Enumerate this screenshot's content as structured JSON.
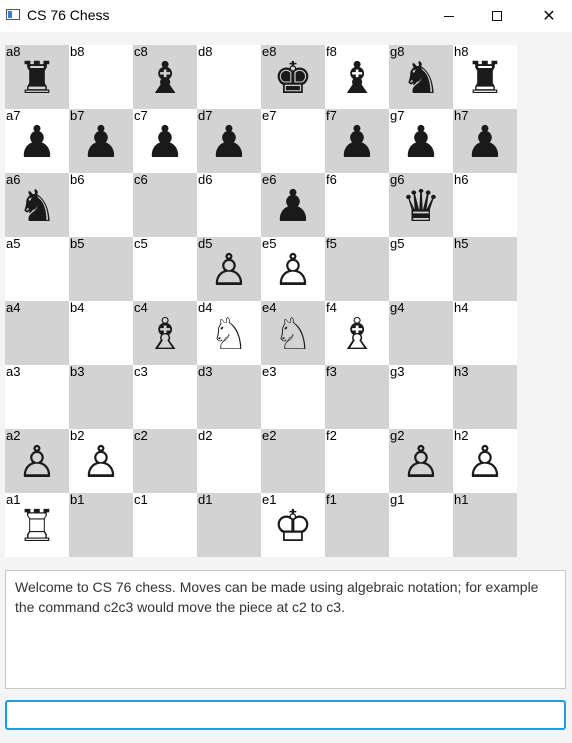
{
  "window": {
    "title": "CS 76 Chess",
    "minimize_glyph": "",
    "maximize_glyph": "",
    "close_glyph": "✕"
  },
  "board": {
    "light_color": "#ffffff",
    "dark_color": "#d3d3d3",
    "files": [
      "a",
      "b",
      "c",
      "d",
      "e",
      "f",
      "g",
      "h"
    ],
    "ranks": [
      "8",
      "7",
      "6",
      "5",
      "4",
      "3",
      "2",
      "1"
    ],
    "pieces": {
      "a8": {
        "glyph": "♜",
        "name": "black-rook"
      },
      "c8": {
        "glyph": "♝",
        "name": "black-bishop"
      },
      "e8": {
        "glyph": "♚",
        "name": "black-king"
      },
      "f8": {
        "glyph": "♝",
        "name": "black-bishop"
      },
      "g8": {
        "glyph": "♞",
        "name": "black-knight"
      },
      "h8": {
        "glyph": "♜",
        "name": "black-rook"
      },
      "a7": {
        "glyph": "♟",
        "name": "black-pawn"
      },
      "b7": {
        "glyph": "♟",
        "name": "black-pawn"
      },
      "c7": {
        "glyph": "♟",
        "name": "black-pawn"
      },
      "d7": {
        "glyph": "♟",
        "name": "black-pawn"
      },
      "f7": {
        "glyph": "♟",
        "name": "black-pawn"
      },
      "g7": {
        "glyph": "♟",
        "name": "black-pawn"
      },
      "h7": {
        "glyph": "♟",
        "name": "black-pawn"
      },
      "a6": {
        "glyph": "♞",
        "name": "black-knight"
      },
      "e6": {
        "glyph": "♟",
        "name": "black-pawn"
      },
      "g6": {
        "glyph": "♛",
        "name": "black-queen"
      },
      "d5": {
        "glyph": "♙",
        "name": "white-pawn"
      },
      "e5": {
        "glyph": "♙",
        "name": "white-pawn"
      },
      "c4": {
        "glyph": "♗",
        "name": "white-bishop"
      },
      "d4": {
        "glyph": "♘",
        "name": "white-knight"
      },
      "e4": {
        "glyph": "♘",
        "name": "white-knight"
      },
      "f4": {
        "glyph": "♗",
        "name": "white-bishop"
      },
      "a2": {
        "glyph": "♙",
        "name": "white-pawn"
      },
      "b2": {
        "glyph": "♙",
        "name": "white-pawn"
      },
      "g2": {
        "glyph": "♙",
        "name": "white-pawn"
      },
      "h2": {
        "glyph": "♙",
        "name": "white-pawn"
      },
      "a1": {
        "glyph": "♖",
        "name": "white-rook"
      },
      "e1": {
        "glyph": "♔",
        "name": "white-king"
      }
    }
  },
  "console": {
    "text": "Welcome to CS 76 chess.  Moves can be made using algebraic notation; for example the command c2c3 would move the piece at c2 to c3."
  },
  "command_input": {
    "value": "",
    "placeholder": ""
  }
}
